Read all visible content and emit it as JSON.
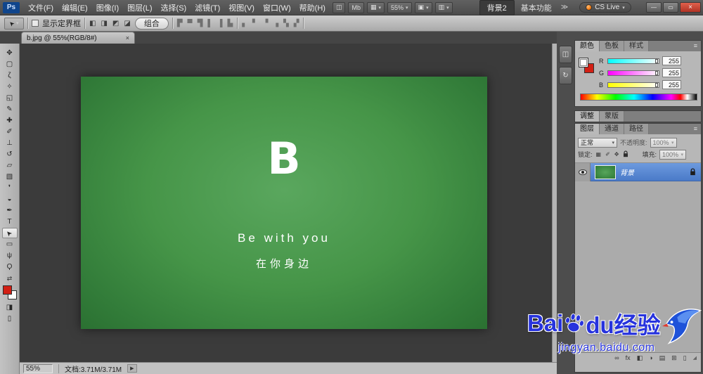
{
  "ui": {
    "caret": "▾"
  },
  "colors": {
    "selection_blue": "#4d7dc6",
    "canvas_green": "#3f8f46",
    "watermark_blue": "#2733dd",
    "close_red": "#b03224",
    "foreground_swatch": "#d21f14"
  },
  "titlebar": {
    "logo": "Ps",
    "menus": [
      "文件(F)",
      "编辑(E)",
      "图像(I)",
      "图层(L)",
      "选择(S)",
      "滤镜(T)",
      "视图(V)",
      "窗口(W)",
      "帮助(H)"
    ],
    "bridge_icon": "◫",
    "minibridge_icon": "Mb",
    "extras_icon": "▦",
    "zoom_value": "55%",
    "arrange_icon": "▣",
    "screenmode_icon": "▥",
    "workspace_active": "背景2",
    "workspace_secondary": "基本功能",
    "workspace_overflow": "≫",
    "cslive_label": "CS Live",
    "minimize_icon": "—",
    "restore_icon": "▭",
    "close_icon": "×"
  },
  "optionsbar": {
    "tool_icon": "➤",
    "bounding_box_label": "显示定界框",
    "path_op_icons": [
      "◧",
      "◨",
      "◩",
      "◪"
    ],
    "combine_label": "组合",
    "align_icons": [
      "▛",
      "▀",
      "▜",
      "▌",
      "▐",
      "▙"
    ],
    "distribute_icons": [
      "▖",
      "▘",
      "▝",
      "▗",
      "▚",
      "▞"
    ]
  },
  "docbar": {
    "tab_title": "b.jpg @ 55%(RGB/8#)",
    "close_icon": "×"
  },
  "tools": [
    {
      "name": "move",
      "glyph": "✥"
    },
    {
      "name": "marquee",
      "glyph": "▢"
    },
    {
      "name": "lasso",
      "glyph": "ζ"
    },
    {
      "name": "quick-select",
      "glyph": "✧"
    },
    {
      "name": "crop",
      "glyph": "◱"
    },
    {
      "name": "eyedropper",
      "glyph": "✎"
    },
    {
      "name": "healing-brush",
      "glyph": "✚"
    },
    {
      "name": "brush",
      "glyph": "✐"
    },
    {
      "name": "clone-stamp",
      "glyph": "⊥"
    },
    {
      "name": "history-brush",
      "glyph": "↺"
    },
    {
      "name": "eraser",
      "glyph": "▱"
    },
    {
      "name": "gradient",
      "glyph": "▧"
    },
    {
      "name": "blur",
      "glyph": "❜"
    },
    {
      "name": "dodge",
      "glyph": "◒"
    },
    {
      "name": "pen",
      "glyph": "✒"
    },
    {
      "name": "type",
      "glyph": "T"
    },
    {
      "name": "path-select",
      "glyph": "➤"
    },
    {
      "name": "shape",
      "glyph": "▭"
    },
    {
      "name": "hand",
      "glyph": "ψ"
    },
    {
      "name": "zoom",
      "glyph": "Ϙ"
    }
  ],
  "toolbar_extras": {
    "swap_icon": "⇄",
    "quickmask_icon": "◨",
    "screenmode_icon": "▯"
  },
  "canvas": {
    "logo_letter": "B",
    "tagline_en": "Be with you",
    "tagline_zh": "在你身边"
  },
  "color_panel": {
    "tabs": [
      "颜色",
      "色板",
      "样式"
    ],
    "menu_icon": "≡",
    "sliders": [
      {
        "label": "R",
        "value": "255"
      },
      {
        "label": "G",
        "value": "255"
      },
      {
        "label": "B",
        "value": "255"
      }
    ]
  },
  "adjust_panel": {
    "tabs": [
      "调整",
      "蒙版"
    ]
  },
  "layers_panel": {
    "tabs": [
      "图层",
      "通道",
      "路径"
    ],
    "menu_icon": "≡",
    "blend_mode": "正常",
    "opacity_label": "不透明度:",
    "opacity_value": "100%",
    "lock_label": "锁定:",
    "lock_icons": [
      "▦",
      "✐",
      "✥"
    ],
    "fill_label": "填充:",
    "fill_value": "100%",
    "layer_name": "背景",
    "footer_icons": [
      "∞",
      "fx",
      "◧",
      "◑",
      "▤",
      "⊞",
      "▯"
    ],
    "grip_icon": "◢"
  },
  "dock": {
    "collapsed_icons": [
      "◫",
      "↻"
    ]
  },
  "statusbar": {
    "zoom": "55%",
    "doc_info": "文档:3.71M/3.71M",
    "arrow_icon": "▶"
  },
  "watermark": {
    "brand_prefix": "Bai",
    "brand_suffix": "du经验",
    "url": "jingyan.baidu.com"
  }
}
